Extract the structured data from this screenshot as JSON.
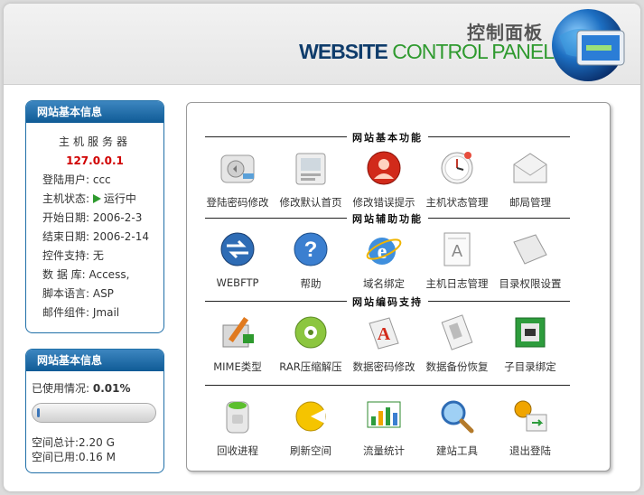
{
  "header": {
    "title_cn": "控制面板",
    "title_en_1": "WEBSITE",
    "title_en_2": "CONTROL PANEL"
  },
  "site_info": {
    "title": "网站基本信息",
    "server_label": "主机服务器",
    "server_ip": "127.0.0.1",
    "rows": [
      "登陆用户: ccc",
      "主机状态: ",
      "开始日期: 2006-2-3",
      "结束日期: 2006-2-14",
      "控件支持: 无",
      "数 据 库: Access,",
      "脚本语言: ASP",
      "邮件组件: Jmail"
    ],
    "status_text": "运行中"
  },
  "usage_info": {
    "title": "网站基本信息",
    "used_label": "已使用情况: ",
    "used_value": "0.01%",
    "used_fraction": 0.0001,
    "total": "空间总计:2.20 G",
    "used": "空间已用:0.16 M"
  },
  "sections": [
    {
      "title": "网站基本功能",
      "items": [
        {
          "label": "登陆密码修改",
          "icon": "key-disk-icon"
        },
        {
          "label": "修改默认首页",
          "icon": "homepage-icon"
        },
        {
          "label": "修改错误提示",
          "icon": "error-user-icon"
        },
        {
          "label": "主机状态管理",
          "icon": "clock-icon"
        },
        {
          "label": "邮局管理",
          "icon": "mail-icon"
        }
      ]
    },
    {
      "title": "网站辅助功能",
      "items": [
        {
          "label": "WEBFTP",
          "icon": "ftp-icon"
        },
        {
          "label": "帮助",
          "icon": "help-icon"
        },
        {
          "label": "域名绑定",
          "icon": "ie-icon"
        },
        {
          "label": "主机日志管理",
          "icon": "log-icon"
        },
        {
          "label": "目录权限设置",
          "icon": "folder-icon"
        }
      ]
    },
    {
      "title": "网站编码支持",
      "items": [
        {
          "label": "MIME类型",
          "icon": "mime-icon"
        },
        {
          "label": "RAR压缩解压",
          "icon": "rar-icon"
        },
        {
          "label": "数据密码修改",
          "icon": "db-password-icon"
        },
        {
          "label": "数据备份恢复",
          "icon": "backup-icon"
        },
        {
          "label": "子目录绑定",
          "icon": "subdir-icon"
        }
      ]
    },
    {
      "title": "",
      "items": [
        {
          "label": "回收进程",
          "icon": "recycle-icon"
        },
        {
          "label": "刷新空间",
          "icon": "refresh-icon"
        },
        {
          "label": "流量统计",
          "icon": "chart-icon"
        },
        {
          "label": "建站工具",
          "icon": "magnifier-icon"
        },
        {
          "label": "退出登陆",
          "icon": "logout-icon"
        }
      ]
    }
  ]
}
